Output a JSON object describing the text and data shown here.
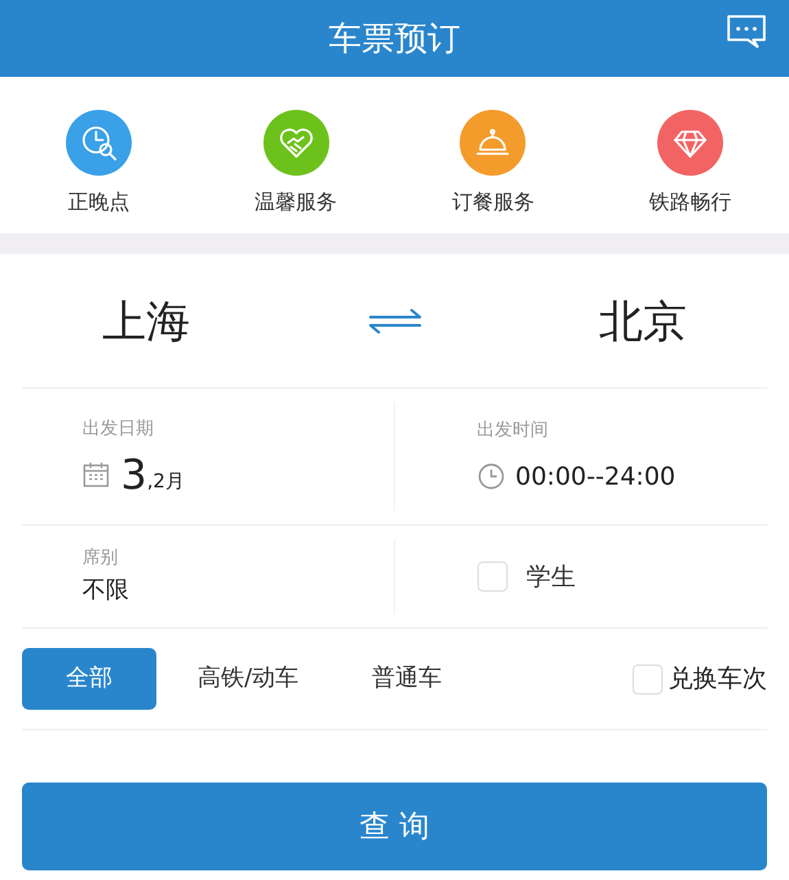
{
  "header": {
    "title": "车票预订"
  },
  "services": [
    {
      "label": "正晚点",
      "kind": "clock",
      "color": "#3aa0e8"
    },
    {
      "label": "温馨服务",
      "kind": "heart",
      "color": "#6cc21a"
    },
    {
      "label": "订餐服务",
      "kind": "dish",
      "color": "#f39b2b"
    },
    {
      "label": "铁路畅行",
      "kind": "diamond",
      "color": "#f26464"
    }
  ],
  "route": {
    "from": "上海",
    "to": "北京"
  },
  "date": {
    "label": "出发日期",
    "day": "3",
    "month": ",2月"
  },
  "time": {
    "label": "出发时间",
    "value": "00:00--24:00"
  },
  "seat": {
    "label": "席别",
    "value": "不限"
  },
  "student": {
    "label": "学生",
    "checked": false
  },
  "train_types": [
    {
      "label": "全部",
      "selected": true
    },
    {
      "label": "高铁/动车",
      "selected": false
    },
    {
      "label": "普通车",
      "selected": false
    }
  ],
  "exchange": {
    "label": "兑换车次",
    "checked": false
  },
  "search_button": "查 询"
}
